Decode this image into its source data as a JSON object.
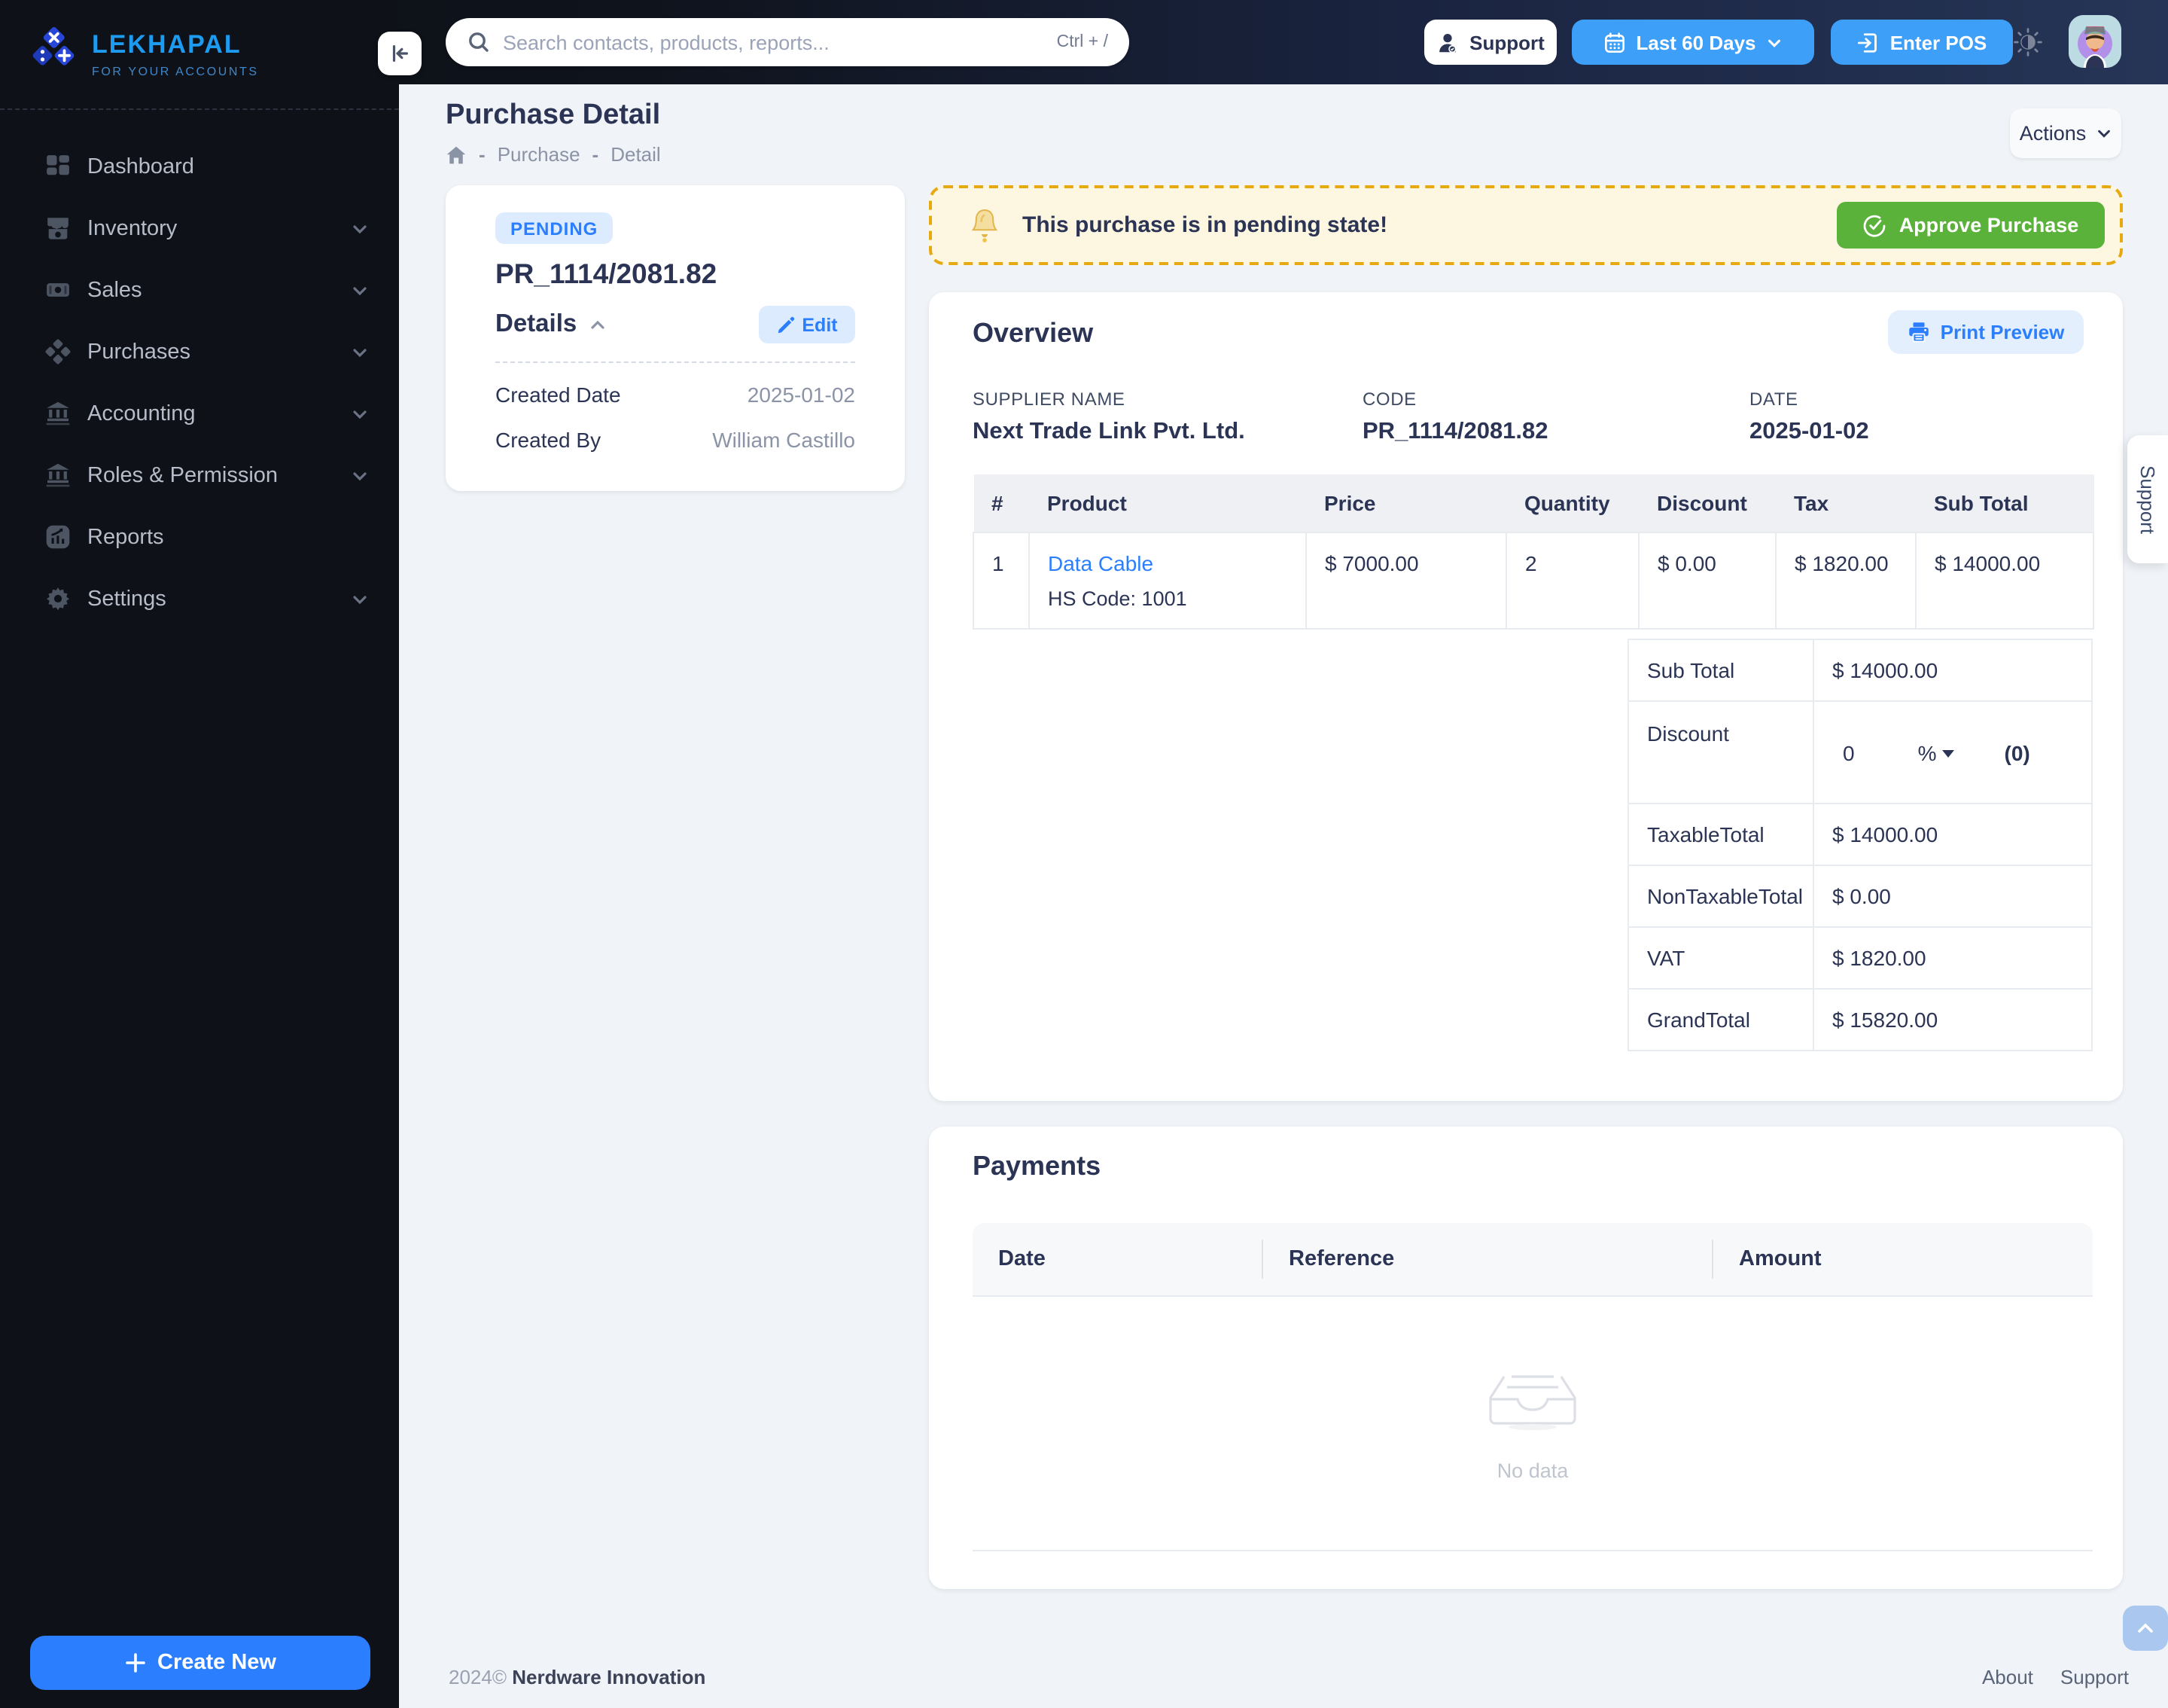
{
  "brand": {
    "name": "LEKHAPAL",
    "tagline": "FOR YOUR ACCOUNTS"
  },
  "topbar": {
    "search_placeholder": "Search contacts, products, reports...",
    "search_shortcut": "Ctrl + /",
    "support_label": "Support",
    "date_range_label": "Last 60 Days",
    "enter_pos_label": "Enter POS"
  },
  "sidebar": {
    "items": [
      {
        "label": "Dashboard"
      },
      {
        "label": "Inventory"
      },
      {
        "label": "Sales"
      },
      {
        "label": "Purchases"
      },
      {
        "label": "Accounting"
      },
      {
        "label": "Roles & Permission"
      },
      {
        "label": "Reports"
      },
      {
        "label": "Settings"
      }
    ],
    "create_new_label": "Create New"
  },
  "page": {
    "title": "Purchase Detail",
    "breadcrumb": [
      "Purchase",
      "Detail"
    ],
    "actions_label": "Actions"
  },
  "detail_card": {
    "status": "PENDING",
    "code": "PR_1114/2081.82",
    "section_title": "Details",
    "edit_label": "Edit",
    "rows": [
      {
        "label": "Created Date",
        "value": "2025-01-02"
      },
      {
        "label": "Created By",
        "value": "William Castillo"
      }
    ]
  },
  "alert": {
    "message": "This purchase is in pending state!",
    "approve_label": "Approve Purchase"
  },
  "overview": {
    "title": "Overview",
    "print_label": "Print Preview",
    "meta": [
      {
        "label": "SUPPLIER NAME",
        "value": "Next Trade Link Pvt. Ltd."
      },
      {
        "label": "CODE",
        "value": "PR_1114/2081.82"
      },
      {
        "label": "DATE",
        "value": "2025-01-02"
      }
    ],
    "items_table": {
      "headers": [
        "#",
        "Product",
        "Price",
        "Quantity",
        "Discount",
        "Tax",
        "Sub Total"
      ],
      "rows": [
        {
          "index": "1",
          "product": "Data Cable",
          "product_sub": "HS Code: 1001",
          "price": "$ 7000.00",
          "quantity": "2",
          "discount": "$ 0.00",
          "tax": "$ 1820.00",
          "sub_total": "$ 14000.00"
        }
      ]
    },
    "totals": [
      {
        "label": "Sub Total",
        "value": "$ 14000.00"
      },
      {
        "label": "Discount",
        "value": "0",
        "unit": "%",
        "count": "(0)"
      },
      {
        "label": "TaxableTotal",
        "value": "$ 14000.00"
      },
      {
        "label": "NonTaxableTotal",
        "value": "$ 0.00"
      },
      {
        "label": "VAT",
        "value": "$ 1820.00"
      },
      {
        "label": "GrandTotal",
        "value": "$ 15820.00"
      }
    ]
  },
  "payments": {
    "title": "Payments",
    "headers": [
      "Date",
      "Reference",
      "Amount"
    ],
    "empty_text": "No data"
  },
  "footer": {
    "year": "2024©",
    "company": "Nerdware Innovation",
    "links": [
      "About",
      "Support"
    ]
  },
  "support_tab": {
    "label": "Support"
  },
  "colors": {
    "accent_blue": "#2b7fff",
    "topbar_blue": "#3d9ff8",
    "badge_bg": "#dcebfe",
    "approve_green": "#5bb23a",
    "alert_bg": "#fdf6e1",
    "alert_border": "#e6a910",
    "navy_text": "#2b3454",
    "sidebar_bg": "#0e1117",
    "content_bg": "#f0f3f7"
  }
}
